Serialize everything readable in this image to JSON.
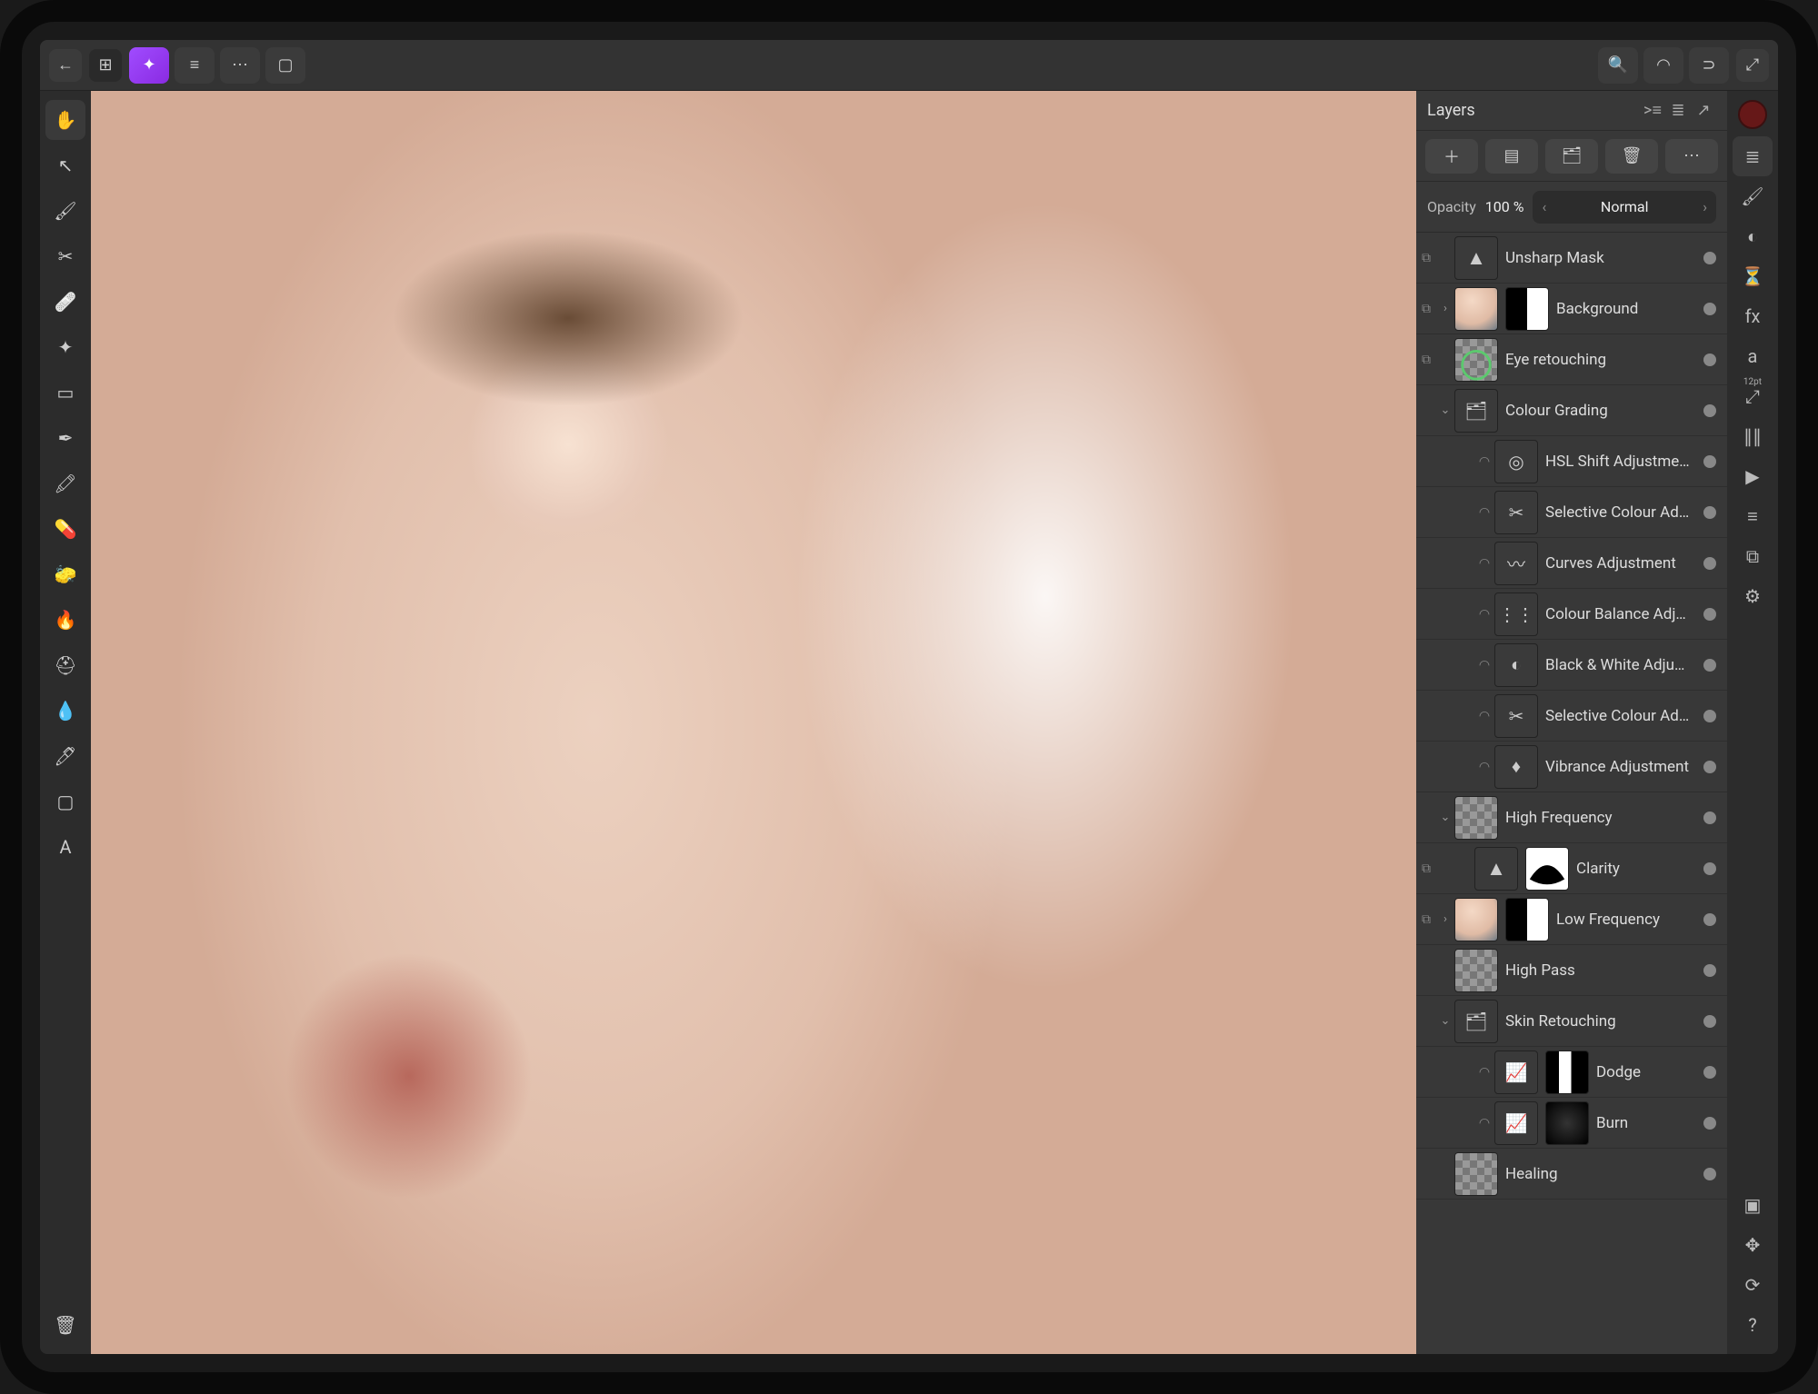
{
  "topbar": {
    "back_label": "←",
    "grid_label": "⊞",
    "menu_label": "≡",
    "more_label": "⋯",
    "marquee_label": "▢"
  },
  "tools": [
    {
      "id": "hand",
      "glyph": "✋"
    },
    {
      "id": "move",
      "glyph": "↖"
    },
    {
      "id": "paint",
      "glyph": "🖌"
    },
    {
      "id": "crop",
      "glyph": "✂"
    },
    {
      "id": "healing",
      "glyph": "🩹"
    },
    {
      "id": "wand",
      "glyph": "✦"
    },
    {
      "id": "marquee",
      "glyph": "▭"
    },
    {
      "id": "pen",
      "glyph": "✒"
    },
    {
      "id": "color-replace",
      "glyph": "🖍"
    },
    {
      "id": "eraser",
      "glyph": "💊"
    },
    {
      "id": "eraser2",
      "glyph": "🧽"
    },
    {
      "id": "burn",
      "glyph": "🔥"
    },
    {
      "id": "stamp",
      "glyph": "⛑"
    },
    {
      "id": "dropper",
      "glyph": "💧"
    },
    {
      "id": "dodge",
      "glyph": "🖊"
    },
    {
      "id": "shape",
      "glyph": "▢"
    },
    {
      "id": "text",
      "glyph": "A"
    }
  ],
  "rightRail": {
    "items": [
      {
        "id": "layers",
        "glyph": "≣",
        "active": true
      },
      {
        "id": "brushes",
        "glyph": "🖌"
      },
      {
        "id": "adjust",
        "glyph": "◐"
      },
      {
        "id": "hourglass",
        "glyph": "⏳"
      },
      {
        "id": "fx",
        "glyph": "fx"
      },
      {
        "id": "text-style",
        "glyph": "a",
        "sub": "12pt"
      },
      {
        "id": "transform",
        "glyph": "⤢"
      },
      {
        "id": "levels",
        "glyph": "∥∥"
      },
      {
        "id": "channels",
        "glyph": "▶"
      },
      {
        "id": "list",
        "glyph": "≡"
      },
      {
        "id": "export",
        "glyph": "⧉"
      },
      {
        "id": "settings",
        "glyph": "⚙"
      }
    ],
    "items2": [
      {
        "id": "bounds",
        "glyph": "▣"
      },
      {
        "id": "snap",
        "glyph": "✥"
      },
      {
        "id": "history",
        "glyph": "⟳"
      },
      {
        "id": "help",
        "glyph": "?"
      }
    ]
  },
  "panel": {
    "title": "Layers",
    "actions": {
      "add": "＋",
      "mask": "▤",
      "group": "🗂",
      "delete": "🗑",
      "more": "⋯"
    },
    "opacity_label": "Opacity",
    "opacity_value": "100 %",
    "blend_mode": "Normal"
  },
  "layers": [
    {
      "type": "adjustment",
      "name": "Unsharp Mask",
      "thumb": "tri",
      "glyph": "▲",
      "depth": 0,
      "link": true,
      "chev": null
    },
    {
      "type": "pixel",
      "name": "Background",
      "thumb": "portrait",
      "mask": true,
      "depth": 0,
      "link": true,
      "chev": ">"
    },
    {
      "type": "pixel",
      "name": "Eye retouching",
      "thumb": "eye",
      "depth": 0,
      "link": true,
      "chev": null
    },
    {
      "type": "group",
      "name": "Colour Grading",
      "thumb": "grp",
      "glyph": "🗂",
      "depth": 0,
      "chev": "v"
    },
    {
      "type": "adjustment",
      "name": "HSL Shift Adjustment",
      "thumb": "adj",
      "glyph": "◎",
      "depth": 1,
      "blend": true
    },
    {
      "type": "adjustment",
      "name": "Selective Colour Adju…",
      "thumb": "adj",
      "glyph": "✂",
      "depth": 1,
      "blend": true
    },
    {
      "type": "adjustment",
      "name": "Curves Adjustment",
      "thumb": "adj",
      "glyph": "〰",
      "depth": 1,
      "blend": true
    },
    {
      "type": "adjustment",
      "name": "Colour Balance Adjust…",
      "thumb": "adj",
      "glyph": "⋮⋮",
      "depth": 1,
      "blend": true
    },
    {
      "type": "adjustment",
      "name": "Black & White Adjust…",
      "thumb": "adj",
      "glyph": "◐",
      "depth": 1,
      "blend": true
    },
    {
      "type": "adjustment",
      "name": "Selective Colour Adju…",
      "thumb": "adj",
      "glyph": "✂",
      "depth": 1,
      "blend": true
    },
    {
      "type": "adjustment",
      "name": "Vibrance Adjustment",
      "thumb": "adj",
      "glyph": "♦",
      "depth": 1,
      "blend": true
    },
    {
      "type": "pixel",
      "name": "High Frequency",
      "thumb": "checker",
      "depth": 0,
      "chev": "v"
    },
    {
      "type": "adjustment",
      "name": "Clarity",
      "thumb": "tri",
      "glyph": "▲",
      "mask": "leaf",
      "depth": 1,
      "link": true
    },
    {
      "type": "pixel",
      "name": "Low Frequency",
      "thumb": "portrait",
      "mask": true,
      "depth": 0,
      "chev": ">",
      "link": true
    },
    {
      "type": "pixel",
      "name": "High Pass",
      "thumb": "checker",
      "depth": 0,
      "chev": null
    },
    {
      "type": "group",
      "name": "Skin Retouching",
      "thumb": "grp",
      "glyph": "🗂",
      "depth": 0,
      "chev": "v"
    },
    {
      "type": "pixel",
      "name": "Dodge",
      "thumb": "adj",
      "glyph": "📈",
      "mask": "bw",
      "depth": 1,
      "blend": true
    },
    {
      "type": "pixel",
      "name": "Burn",
      "thumb": "adj",
      "glyph": "📈",
      "mask": "dark",
      "depth": 1,
      "blend": true
    },
    {
      "type": "pixel",
      "name": "Healing",
      "thumb": "checker",
      "depth": 0,
      "chev": null
    }
  ]
}
